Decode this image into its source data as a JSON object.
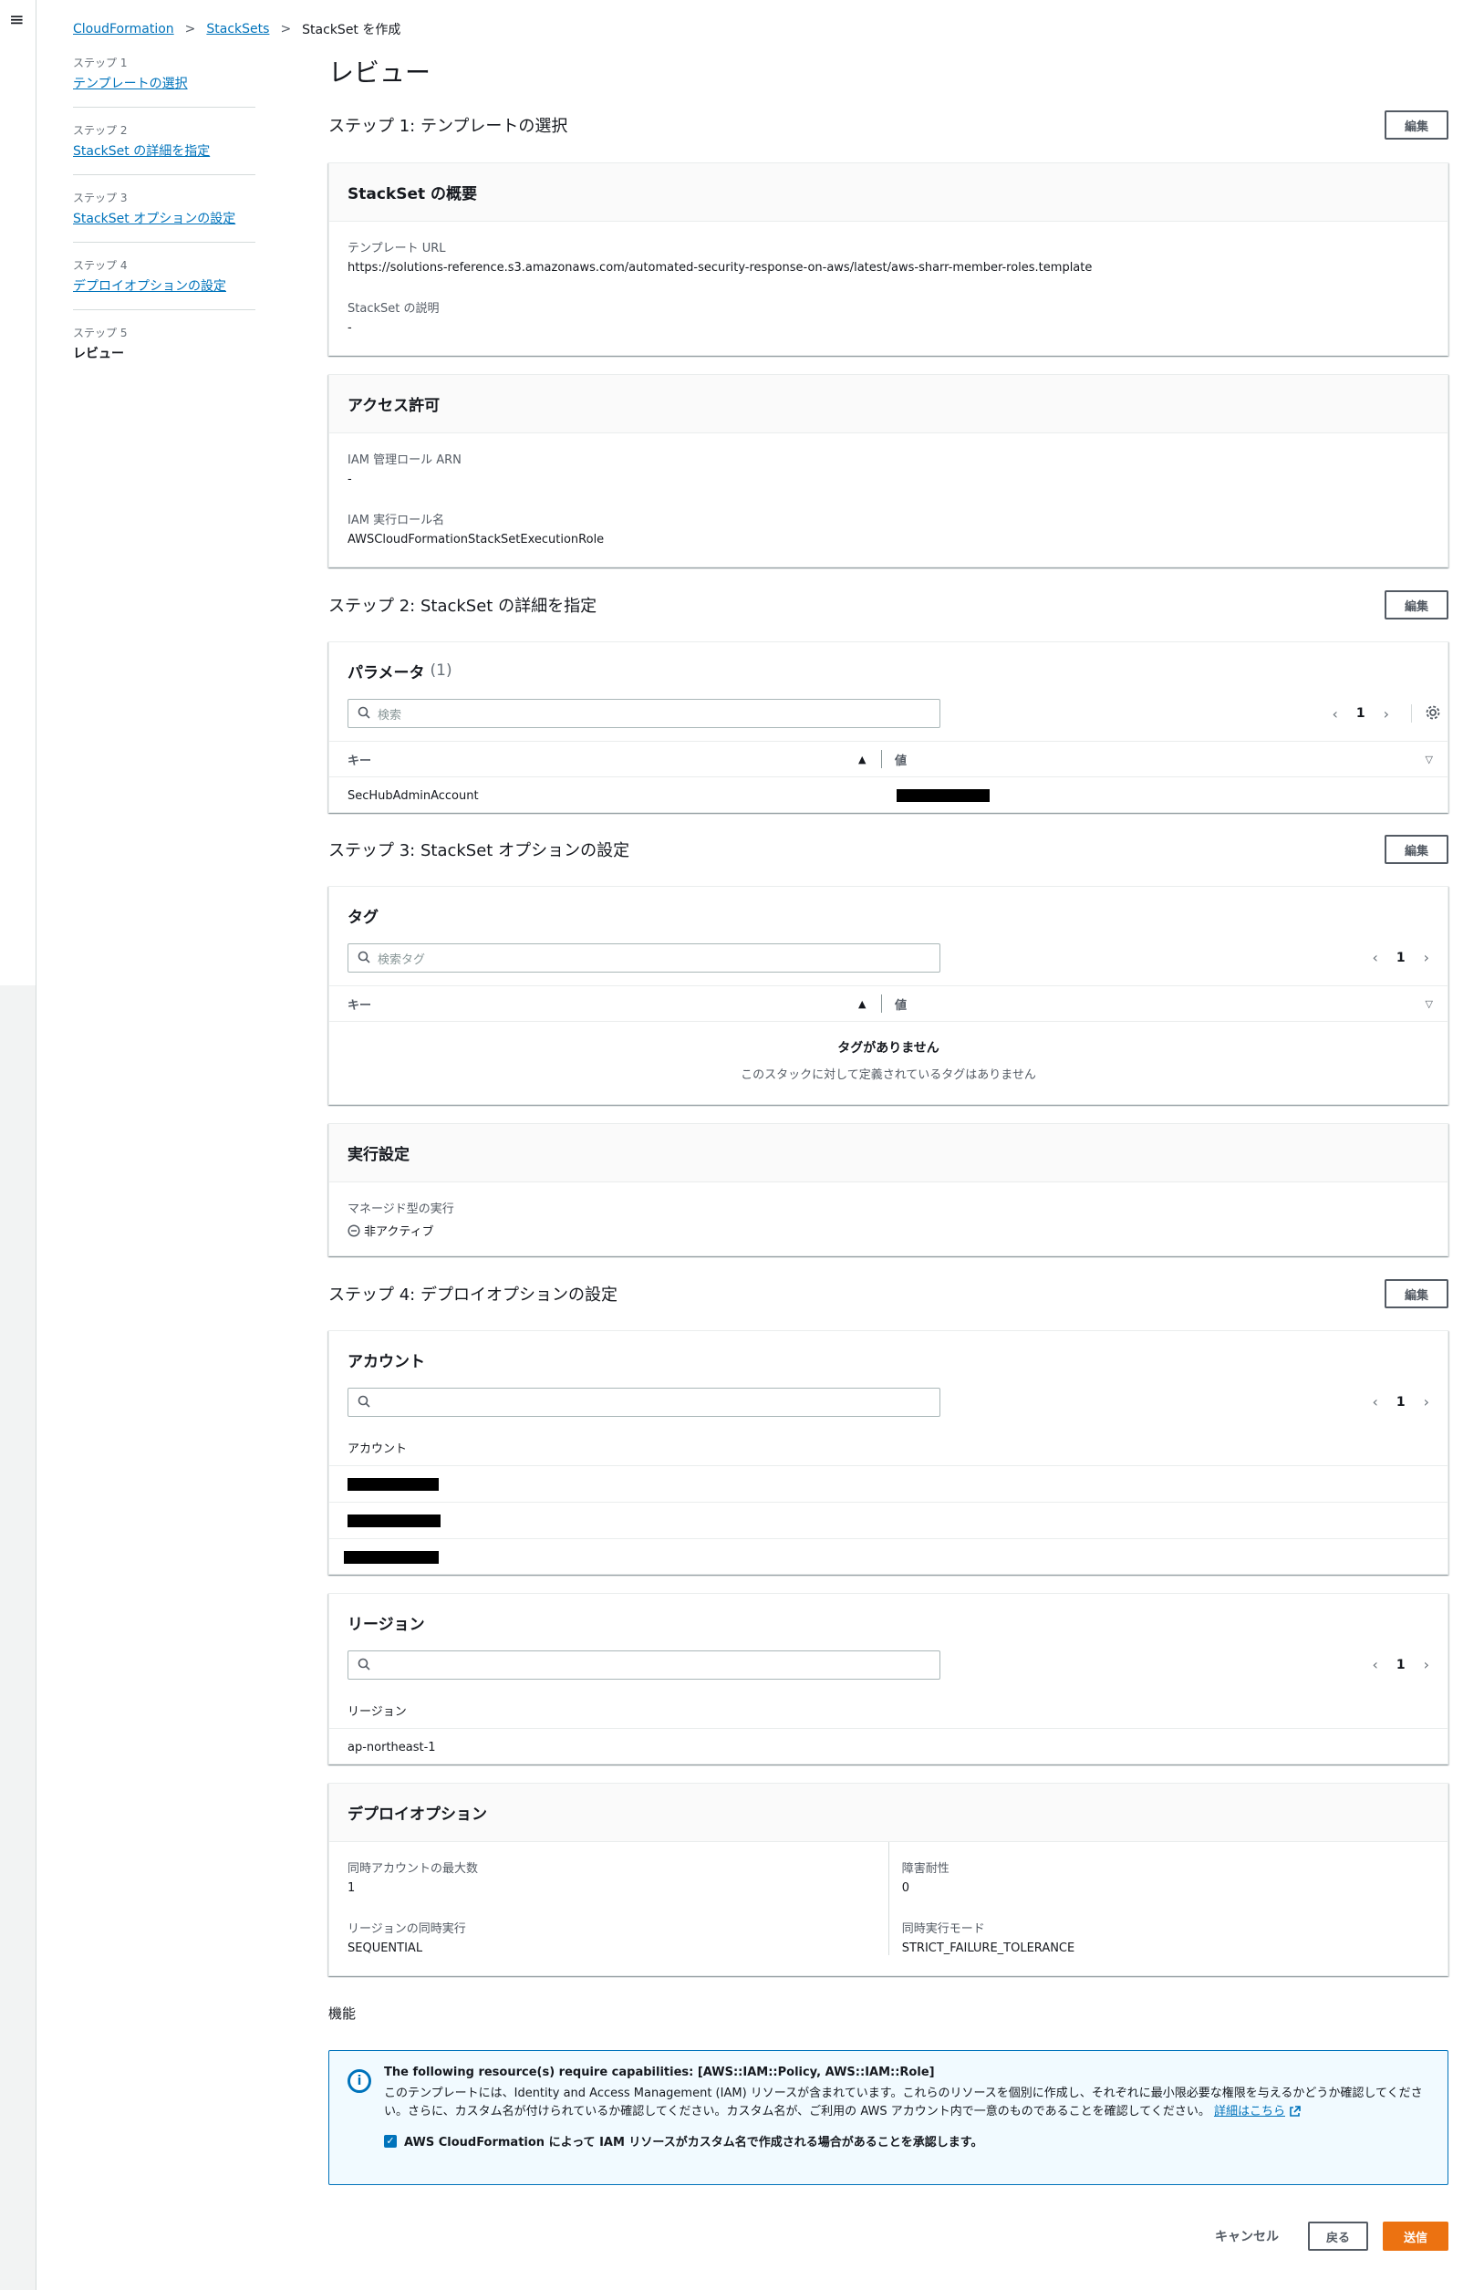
{
  "nav": {
    "menu_icon": "≡"
  },
  "breadcrumb": {
    "items": [
      "CloudFormation",
      "StackSets"
    ],
    "current": "StackSet を作成"
  },
  "steps": [
    {
      "no": "ステップ 1",
      "label": "テンプレートの選択"
    },
    {
      "no": "ステップ 2",
      "label": "StackSet の詳細を指定"
    },
    {
      "no": "ステップ 3",
      "label": "StackSet オプションの設定"
    },
    {
      "no": "ステップ 4",
      "label": "デプロイオプションの設定"
    },
    {
      "no": "ステップ 5",
      "label": "レビュー"
    }
  ],
  "page_title": "レビュー",
  "edit_label": "編集",
  "step1": {
    "title": "ステップ 1: テンプレートの選択",
    "overview": {
      "heading": "StackSet の概要",
      "template_url_label": "テンプレート URL",
      "template_url": "https://solutions-reference.s3.amazonaws.com/automated-security-response-on-aws/latest/aws-sharr-member-roles.template",
      "description_label": "StackSet の説明",
      "description": "-"
    },
    "permissions": {
      "heading": "アクセス許可",
      "admin_role_label": "IAM 管理ロール ARN",
      "admin_role": "-",
      "exec_role_label": "IAM 実行ロール名",
      "exec_role": "AWSCloudFormationStackSetExecutionRole"
    }
  },
  "step2": {
    "title": "ステップ 2: StackSet の詳細を指定",
    "params": {
      "heading": "パラメータ",
      "count": "(1)",
      "search_placeholder": "検索",
      "page": "1",
      "col_key": "キー",
      "col_value": "値",
      "rows": [
        {
          "key": "SecHubAdminAccount"
        }
      ]
    }
  },
  "step3": {
    "title": "ステップ 3: StackSet オプションの設定",
    "tags": {
      "heading": "タグ",
      "search_placeholder": "検索タグ",
      "page": "1",
      "col_key": "キー",
      "col_value": "値",
      "empty_title": "タグがありません",
      "empty_desc": "このスタックに対して定義されているタグはありません"
    },
    "exec": {
      "heading": "実行設定",
      "managed_label": "マネージド型の実行",
      "managed_value": "非アクティブ"
    }
  },
  "step4": {
    "title": "ステップ 4: デプロイオプションの設定",
    "accounts": {
      "heading": "アカウント",
      "page": "1",
      "col": "アカウント"
    },
    "regions": {
      "heading": "リージョン",
      "page": "1",
      "col": "リージョン",
      "rows": [
        "ap-northeast-1"
      ]
    },
    "deploy": {
      "heading": "デプロイオプション",
      "max_concurrent_label": "同時アカウントの最大数",
      "max_concurrent": "1",
      "failure_tol_label": "障害耐性",
      "failure_tol": "0",
      "region_concurrency_label": "リージョンの同時実行",
      "region_concurrency": "SEQUENTIAL",
      "concurrency_mode_label": "同時実行モード",
      "concurrency_mode": "STRICT_FAILURE_TOLERANCE"
    }
  },
  "capabilities": {
    "title": "機能",
    "box_title": "The following resource(s) require capabilities: [AWS::IAM::Policy, AWS::IAM::Role]",
    "body": "このテンプレートには、Identity and Access Management (IAM) リソースが含まれています。これらのリソースを個別に作成し、それぞれに最小限必要な権限を与えるかどうか確認してください。さらに、カスタム名が付けられているか確認してください。カスタム名が、ご利用の AWS アカウント内で一意のものであることを確認してください。",
    "link": "詳細はこちら",
    "ack": "AWS CloudFormation によって IAM リソースがカスタム名で作成される場合があることを承認します。"
  },
  "footer": {
    "cancel": "キャンセル",
    "back": "戻る",
    "submit": "送信"
  }
}
